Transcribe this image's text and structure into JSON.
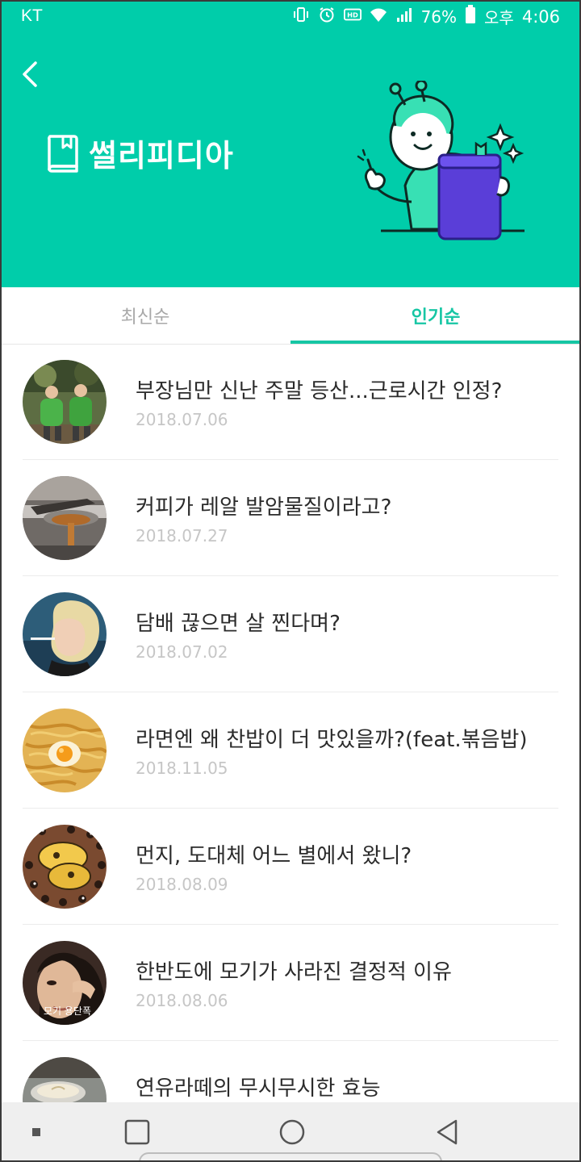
{
  "status_bar": {
    "carrier": "KT",
    "battery": "76%",
    "ampm": "오후",
    "time": "4:06",
    "icons": [
      "vibrate-icon",
      "alarm-icon",
      "hd-icon",
      "wifi-icon",
      "signal-icon",
      "battery-icon"
    ]
  },
  "header": {
    "back_icon": "chevron-left-icon",
    "logo_icon": "book-icon",
    "title": "썰리피디아",
    "bg_color": "#00cdaa"
  },
  "tabs": [
    {
      "label": "최신순",
      "active": false
    },
    {
      "label": "인기순",
      "active": true
    }
  ],
  "accent_color": "#16c6a4",
  "articles": [
    {
      "title": "부장님만 신난 주말 등산...근로시간 인정?",
      "date": "2018.07.06"
    },
    {
      "title": "커피가 레알 발암물질이라고?",
      "date": "2018.07.27"
    },
    {
      "title": "담배 끊으면 살 찐다며?",
      "date": "2018.07.02"
    },
    {
      "title": "라면엔 왜 찬밥이 더 맛있을까?(feat.볶음밥)",
      "date": "2018.11.05"
    },
    {
      "title": "먼지, 도대체 어느 별에서 왔니?",
      "date": "2018.08.09"
    },
    {
      "title": "한반도에 모기가 사라진 결정적 이유",
      "date": "2018.08.06"
    },
    {
      "title": "연유라떼의 무시무시한 효능",
      "date": ""
    }
  ],
  "thumb_caption": "모기 용단폭",
  "navbar": {
    "buttons": [
      "recent-apps-dot-icon",
      "overview-square-icon",
      "home-circle-icon",
      "back-triangle-icon"
    ]
  }
}
